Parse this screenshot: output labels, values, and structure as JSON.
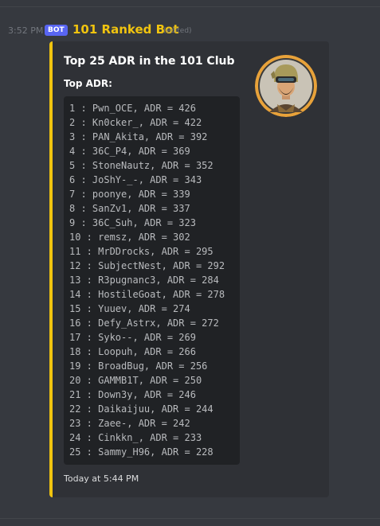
{
  "message": {
    "timestamp": "3:52 PM",
    "badge": "BOT",
    "author": "101 Ranked Bot",
    "edited": "(edited)"
  },
  "embed": {
    "title": "Top 25 ADR in the 101 Club",
    "field_name": "Top ADR:",
    "footer": "Today at 5:44 PM",
    "accent_color": "#f1c40f",
    "thumbnail_icon": "pubg-helmet-avatar",
    "lines": [
      "1 : Pwn_OCE, ADR = 426",
      "2 : Kn0cker_, ADR = 422",
      "3 : PAN_Akita, ADR = 392",
      "4 : 36C_P4, ADR = 369",
      "5 : StoneNautz, ADR = 352",
      "6 : JoShY-_-, ADR = 343",
      "7 : poonye, ADR = 339",
      "8 : SanZv1, ADR = 337",
      "9 : 36C_Suh, ADR = 323",
      "10 : remsz, ADR = 302",
      "11 : MrDDrocks, ADR = 295",
      "12 : SubjectNest, ADR = 292",
      "13 : R3pugnanc3, ADR = 284",
      "14 : HostileGoat, ADR = 278",
      "15 : Yuuev, ADR = 274",
      "16 : Defy_Astrx, ADR = 272",
      "17 : Syko--, ADR = 269",
      "18 : Loopuh, ADR = 266",
      "19 : BroadBug, ADR = 256",
      "20 : GAMMB1T, ADR = 250",
      "21 : Down3y, ADR = 246",
      "22 : Daikaijuu, ADR = 244",
      "23 : Zaee-, ADR = 242",
      "24 : Cinkkn_, ADR = 233",
      "25 : Sammy_H96, ADR = 228"
    ]
  }
}
